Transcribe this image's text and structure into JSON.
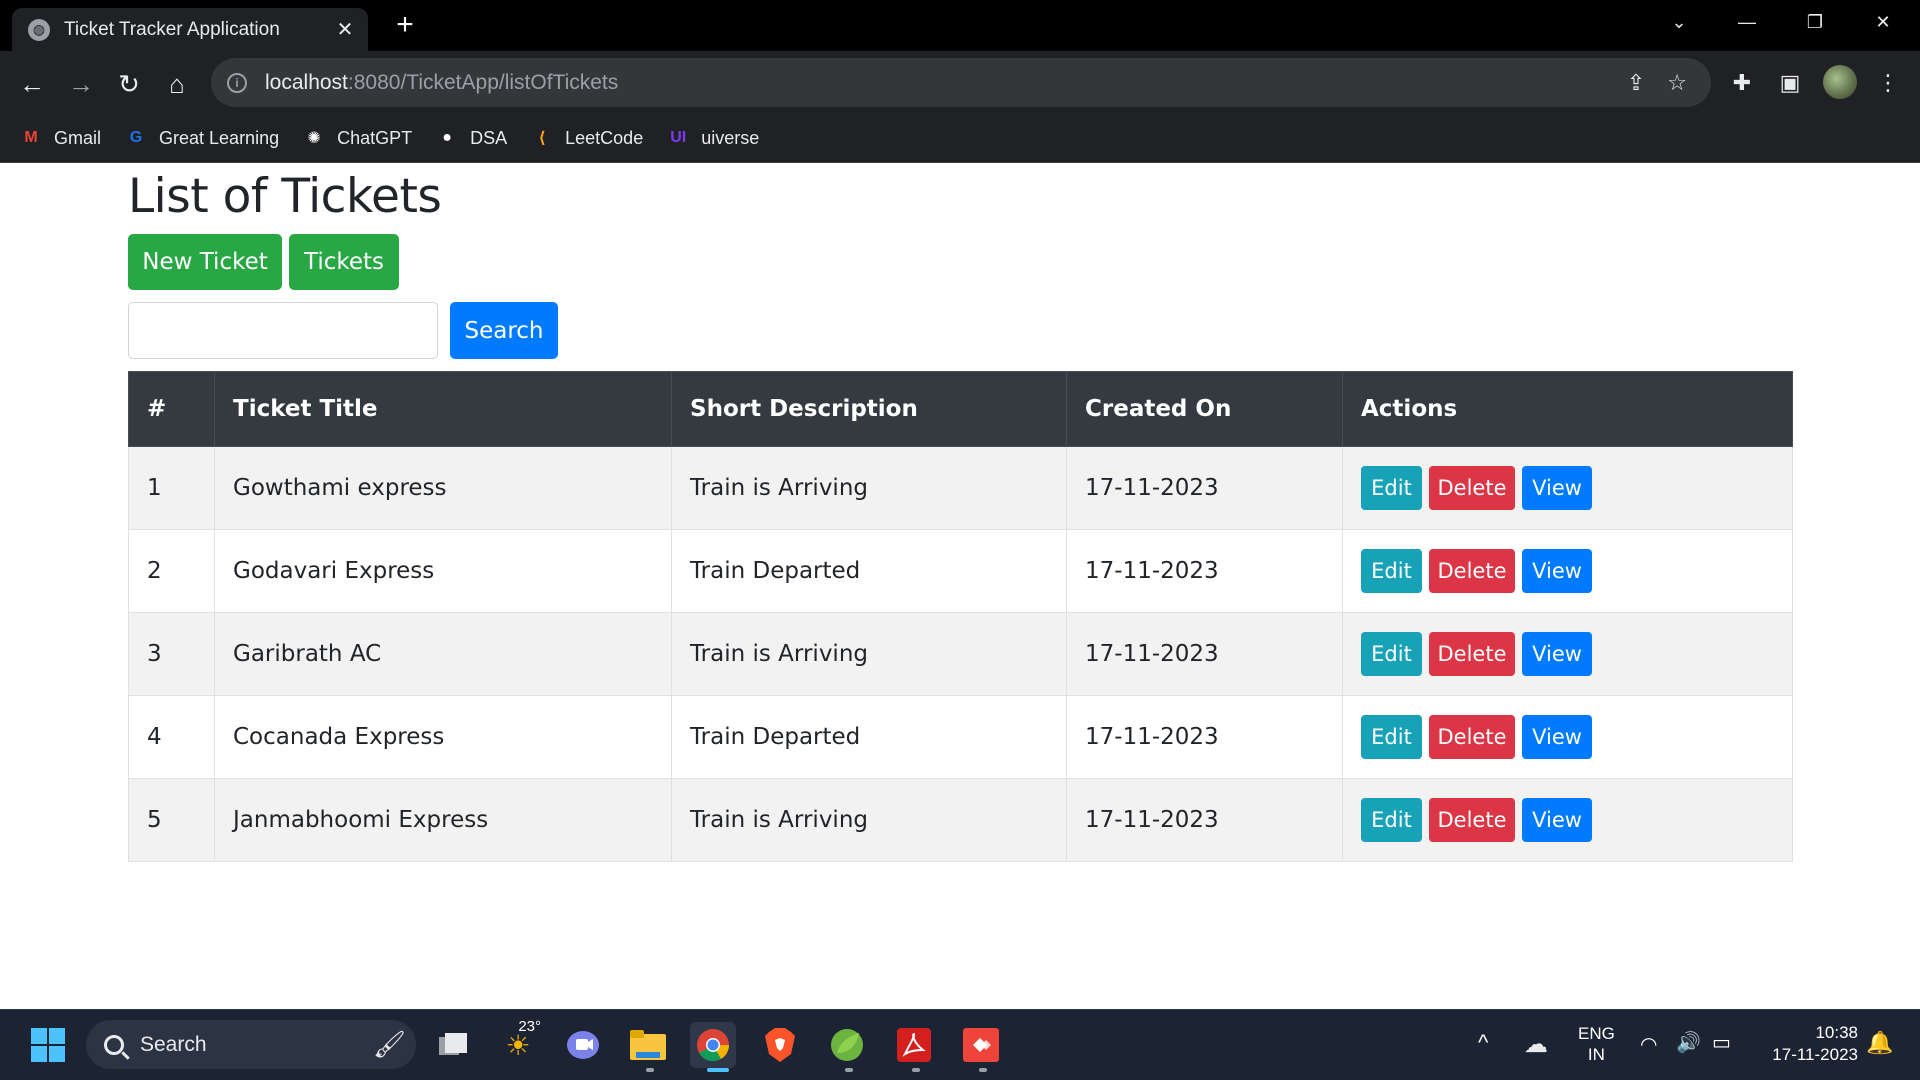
{
  "browser": {
    "tab_title": "Ticket Tracker Application",
    "tab_close": "✕",
    "new_tab": "+",
    "url_host": "localhost",
    "url_path": ":8080/TicketApp/listOfTickets",
    "bookmarks": [
      {
        "label": "Gmail",
        "icon": "gmail-icon",
        "glyph": "M",
        "color": "#ea4335"
      },
      {
        "label": "Great Learning",
        "icon": "great-learning-icon",
        "glyph": "G",
        "color": "#1a73e8"
      },
      {
        "label": "ChatGPT",
        "icon": "chatgpt-icon",
        "glyph": "✺",
        "color": "#ffffff"
      },
      {
        "label": "DSA",
        "icon": "github-icon",
        "glyph": "●",
        "color": "#ffffff"
      },
      {
        "label": "LeetCode",
        "icon": "leetcode-icon",
        "glyph": "⟨",
        "color": "#ffa116"
      },
      {
        "label": "uiverse",
        "icon": "uiverse-icon",
        "glyph": "UI",
        "color": "#7c3aed"
      }
    ]
  },
  "page": {
    "title": "List of Tickets",
    "new_ticket_label": "New Ticket",
    "tickets_label": "Tickets",
    "search_value": "",
    "search_label": "Search"
  },
  "table": {
    "headers": [
      "#",
      "Ticket Title",
      "Short Description",
      "Created On",
      "Actions"
    ],
    "rows": [
      {
        "id": "1",
        "title": "Gowthami express",
        "description": "Train is Arriving",
        "created": "17-11-2023"
      },
      {
        "id": "2",
        "title": "Godavari Express",
        "description": "Train Departed",
        "created": "17-11-2023"
      },
      {
        "id": "3",
        "title": "Garibrath AC",
        "description": "Train is Arriving",
        "created": "17-11-2023"
      },
      {
        "id": "4",
        "title": "Cocanada Express",
        "description": "Train Departed",
        "created": "17-11-2023"
      },
      {
        "id": "5",
        "title": "Janmabhoomi Express",
        "description": "Train is Arriving",
        "created": "17-11-2023"
      }
    ],
    "edit_label": "Edit",
    "delete_label": "Delete",
    "view_label": "View"
  },
  "taskbar": {
    "search_label": "Search",
    "weather_temp": "23°",
    "language_line1": "ENG",
    "language_line2": "IN",
    "time": "10:38",
    "date": "17-11-2023"
  },
  "colors": {
    "success": "#28a745",
    "primary": "#007bff",
    "info": "#17a2b8",
    "danger": "#dc3545",
    "table_header": "#343a40"
  }
}
